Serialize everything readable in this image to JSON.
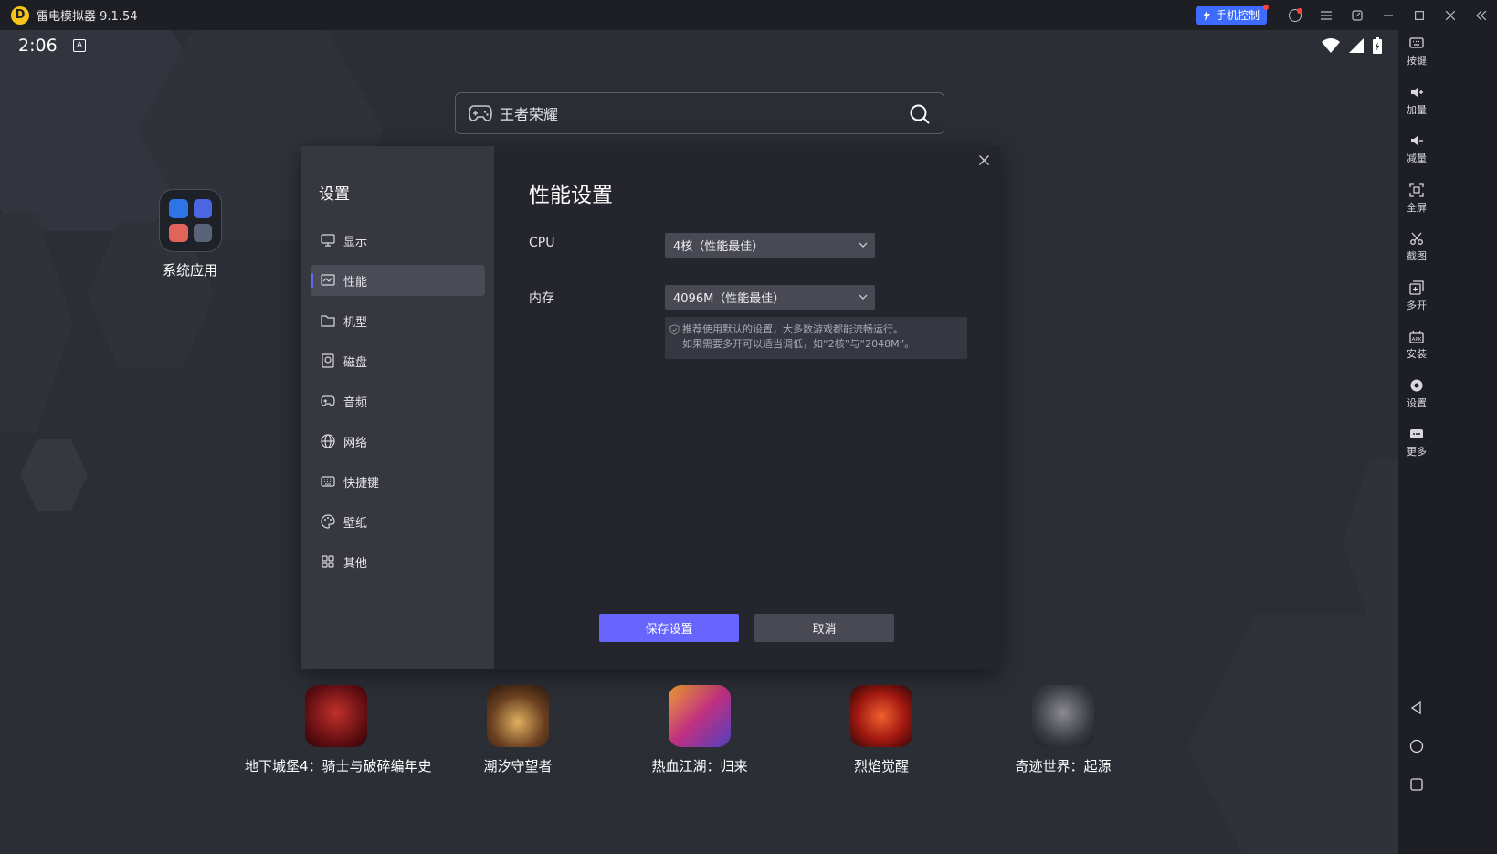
{
  "window": {
    "title": "雷电模拟器 9.1.54",
    "logo_letter": "D",
    "phone_control_label": "手机控制"
  },
  "statusbar": {
    "time": "2:06",
    "a_badge": "A"
  },
  "search": {
    "text": "王者荣耀"
  },
  "folder": {
    "label": "系统应用"
  },
  "games": [
    {
      "label": "地下城堡4：骑士与破碎编年史"
    },
    {
      "label": "潮汐守望者"
    },
    {
      "label": "热血江湖：归来"
    },
    {
      "label": "烈焰觉醒"
    },
    {
      "label": "奇迹世界：起源"
    }
  ],
  "settings": {
    "sidebar_title": "设置",
    "menu": [
      {
        "label": "显示",
        "icon": "monitor-icon"
      },
      {
        "label": "性能",
        "icon": "performance-icon",
        "active": true
      },
      {
        "label": "机型",
        "icon": "folder-icon"
      },
      {
        "label": "磁盘",
        "icon": "disk-icon"
      },
      {
        "label": "音频",
        "icon": "gamepad-icon"
      },
      {
        "label": "网络",
        "icon": "globe-icon"
      },
      {
        "label": "快捷键",
        "icon": "keyboard-icon"
      },
      {
        "label": "壁纸",
        "icon": "palette-icon"
      },
      {
        "label": "其他",
        "icon": "grid-icon"
      }
    ],
    "title": "性能设置",
    "cpu_label": "CPU",
    "cpu_value": "4核（性能最佳）",
    "memory_label": "内存",
    "memory_value": "4096M（性能最佳）",
    "hint_line1": "推荐使用默认的设置，大多数游戏都能流畅运行。",
    "hint_line2": "如果需要多开可以适当调低，如“2核”与“2048M”。",
    "save_label": "保存设置",
    "cancel_label": "取消"
  },
  "toolbar": [
    {
      "label": "按键",
      "icon": "keyboard-icon"
    },
    {
      "label": "加量",
      "icon": "volume-up-icon"
    },
    {
      "label": "减量",
      "icon": "volume-down-icon"
    },
    {
      "label": "全屏",
      "icon": "fullscreen-icon"
    },
    {
      "label": "截图",
      "icon": "scissors-icon"
    },
    {
      "label": "多开",
      "icon": "multi-instance-icon"
    },
    {
      "label": "安装",
      "icon": "apk-icon"
    },
    {
      "label": "设置",
      "icon": "gear-icon"
    },
    {
      "label": "更多",
      "icon": "more-icon"
    }
  ],
  "colors": {
    "accent": "#6666ff",
    "phone_control_bg": "#3d6bff",
    "titlebar_bg": "#1d1f25"
  }
}
